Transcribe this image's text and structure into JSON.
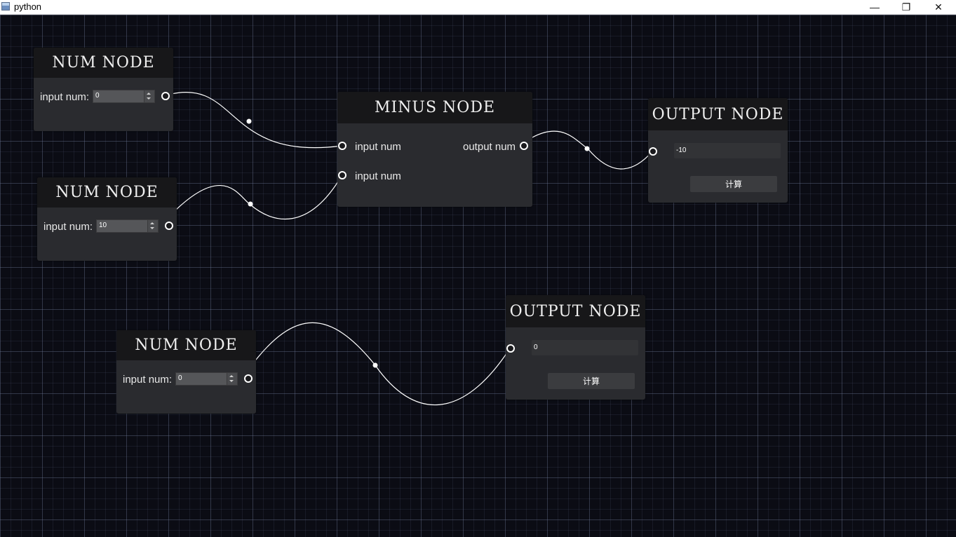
{
  "window": {
    "title": "python",
    "minimize_glyph": "—",
    "maximize_glyph": "❐",
    "close_glyph": "✕"
  },
  "num_nodes": [
    {
      "title": "NUM NODE",
      "label": "input num:",
      "value": "0"
    },
    {
      "title": "NUM NODE",
      "label": "input num:",
      "value": "10"
    },
    {
      "title": "NUM NODE",
      "label": "input num:",
      "value": "0"
    }
  ],
  "minus_node": {
    "title": "MINUS NODE",
    "input_1": "input num",
    "input_2": "input num",
    "output": "output num"
  },
  "output_nodes": [
    {
      "title": "OUTPUT NODE",
      "value": "-10",
      "button": "计算"
    },
    {
      "title": "OUTPUT NODE",
      "value": "0",
      "button": "计算"
    }
  ],
  "colors": {
    "canvas_bg": "#0b0c14",
    "node_bg": "#2a2b2f",
    "node_header": "#171719",
    "edge": "#ffffff"
  }
}
